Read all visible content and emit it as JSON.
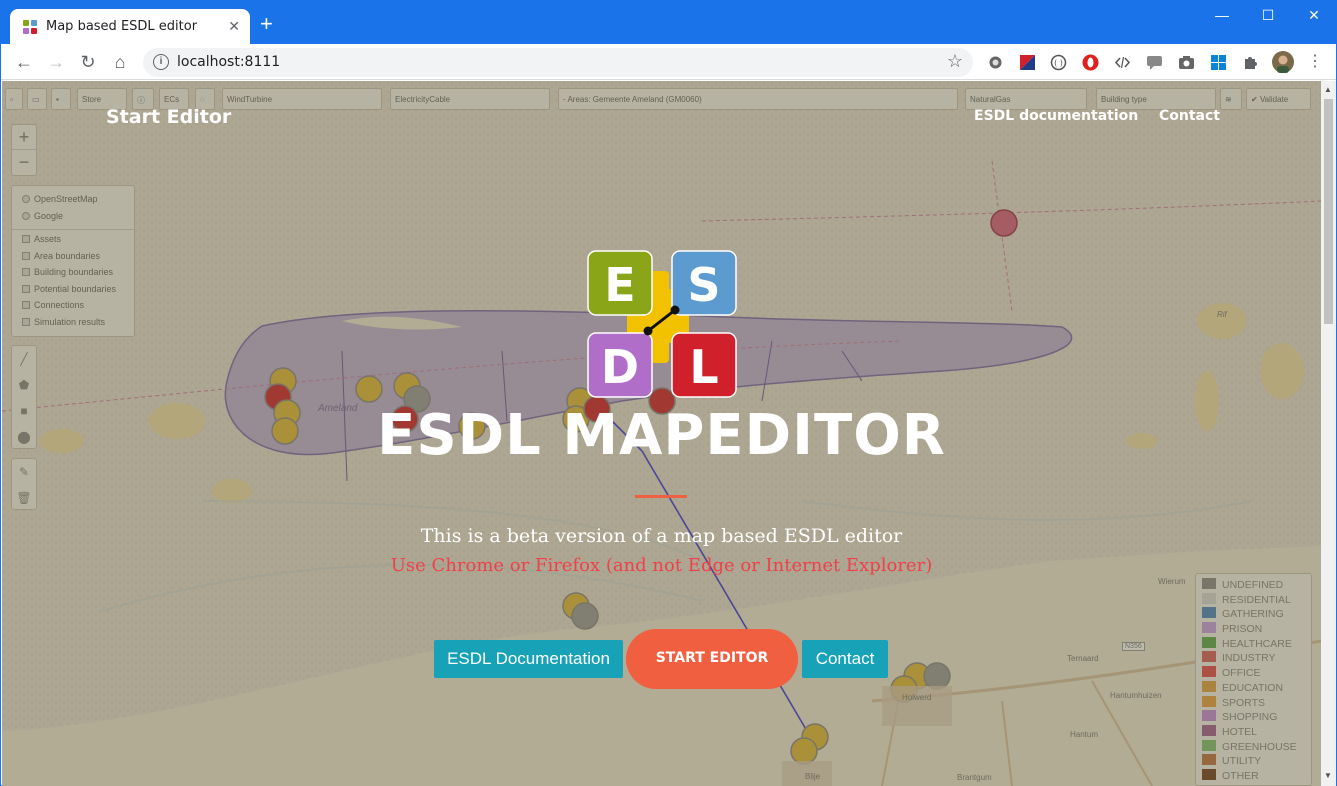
{
  "browser": {
    "tab_title": "Map based ESDL editor",
    "tab_close": "✕",
    "new_tab": "+",
    "url": "localhost:8111",
    "window_controls": {
      "minimize": "—",
      "maximize": "☐",
      "close": "✕"
    },
    "nav": {
      "back": "←",
      "forward": "→",
      "reload": "↻",
      "home": "⌂"
    },
    "star": "☆",
    "info": "i"
  },
  "map": {
    "toolbar": {
      "store": "Store",
      "ecs": "ECs",
      "asset_select": "WindTurbine",
      "cable_select": "ElectricityCable",
      "area_select": "- Areas: Gemeente Ameland (GM0060)",
      "gas_select": "NaturalGas",
      "building_select": "Building type",
      "validate": "Validate"
    },
    "zoom_in": "+",
    "zoom_out": "−",
    "layers": [
      {
        "label": "OpenStreetMap",
        "kind": "radio"
      },
      {
        "label": "Google",
        "kind": "radio"
      },
      {
        "label": "Assets",
        "kind": "check"
      },
      {
        "label": "Area boundaries",
        "kind": "check"
      },
      {
        "label": "Building boundaries",
        "kind": "check"
      },
      {
        "label": "Potential boundaries",
        "kind": "check"
      },
      {
        "label": "Connections",
        "kind": "check"
      },
      {
        "label": "Simulation results",
        "kind": "check"
      }
    ],
    "place_labels": {
      "ameland": "Ameland",
      "ternaard": "Ternaard",
      "holwerd": "Holwerd",
      "hantum": "Hantum",
      "hantumhuizen": "Hantumhuizen",
      "blije": "Blije",
      "brantgum": "Brantgum",
      "wierum": "Wierum",
      "n356": "N356",
      "rif": "Rif"
    },
    "legend": [
      {
        "label": "UNDEFINED",
        "color": "#8a8a8a"
      },
      {
        "label": "RESIDENTIAL",
        "color": "#d8d8d8"
      },
      {
        "label": "GATHERING",
        "color": "#4e86c0"
      },
      {
        "label": "PRISON",
        "color": "#c8a0e0"
      },
      {
        "label": "HEALTHCARE",
        "color": "#5aa84a"
      },
      {
        "label": "INDUSTRY",
        "color": "#d86060"
      },
      {
        "label": "OFFICE",
        "color": "#e64a4a"
      },
      {
        "label": "EDUCATION",
        "color": "#e0a040"
      },
      {
        "label": "SPORTS",
        "color": "#e8a040"
      },
      {
        "label": "SHOPPING",
        "color": "#c98ad8"
      },
      {
        "label": "HOTEL",
        "color": "#a06090"
      },
      {
        "label": "GREENHOUSE",
        "color": "#80c070"
      },
      {
        "label": "UTILITY",
        "color": "#c07040"
      },
      {
        "label": "OTHER",
        "color": "#704020"
      }
    ]
  },
  "site": {
    "brand": "Start Editor",
    "nav_docs": "ESDL documentation",
    "nav_contact": "Contact",
    "logo_letters": {
      "e": "E",
      "s": "S",
      "d": "D",
      "l": "L"
    },
    "title": "ESDL MAPEDITOR",
    "subtitle": "This is a beta version of a map based ESDL editor",
    "warning": "Use Chrome or Firefox (and not Edge or Internet Explorer)",
    "btn_docs": "ESDL Documentation",
    "btn_start": "START EDITOR",
    "btn_contact": "Contact"
  },
  "colors": {
    "logo_e": "#8aa517",
    "logo_s": "#5b9bd0",
    "logo_d": "#b06ec8",
    "logo_l": "#d0202c",
    "logo_center": "#f2c200",
    "accent": "#f05f40",
    "teal": "#17a2b8",
    "warning": "#f0404a"
  }
}
